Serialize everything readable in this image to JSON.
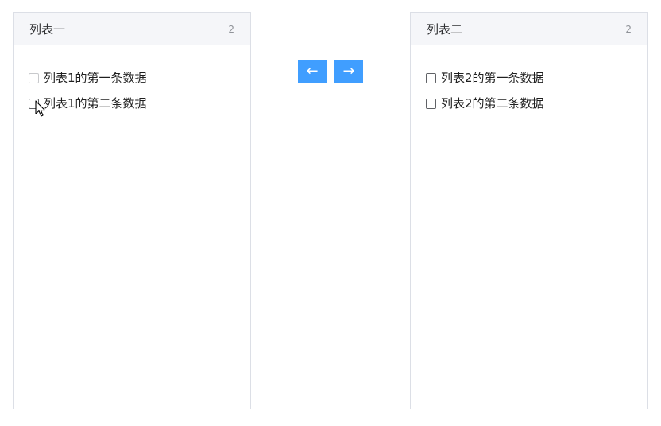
{
  "left_panel": {
    "title": "列表一",
    "count": "2",
    "items": [
      {
        "label": "列表1的第一条数据",
        "checked": false,
        "disabled": true
      },
      {
        "label": "列表1的第二条数据",
        "checked": false,
        "disabled": false
      }
    ]
  },
  "right_panel": {
    "title": "列表二",
    "count": "2",
    "items": [
      {
        "label": "列表2的第一条数据",
        "checked": false,
        "disabled": false
      },
      {
        "label": "列表2的第二条数据",
        "checked": false,
        "disabled": false
      }
    ]
  },
  "controls": {
    "move_left_label": "←",
    "move_right_label": "→",
    "button_color": "#409eff"
  },
  "icons": {
    "cursor": "mouse-pointer-icon"
  }
}
